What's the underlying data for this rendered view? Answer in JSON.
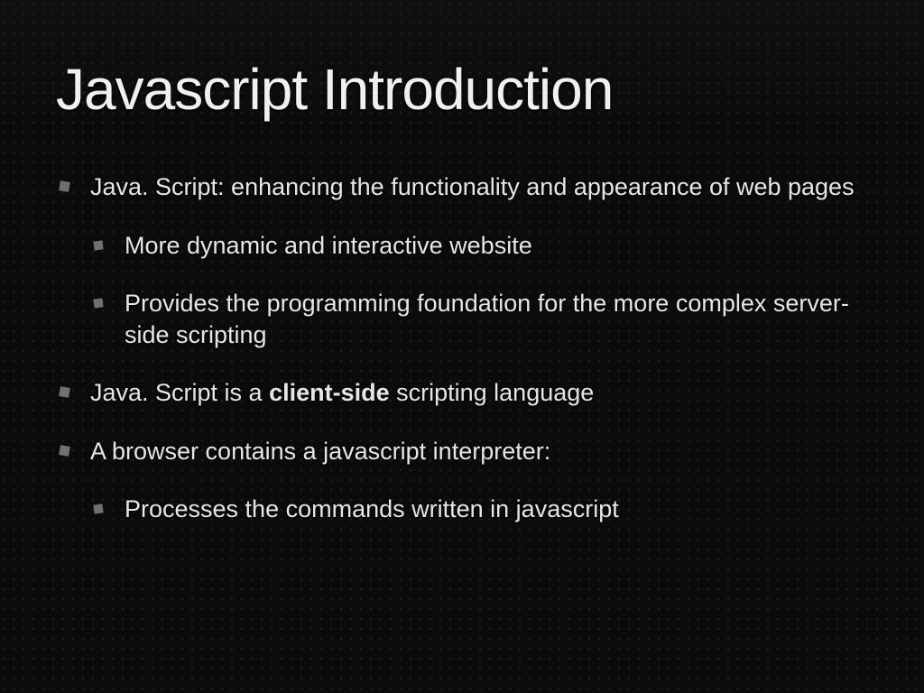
{
  "title": "Javascript Introduction",
  "bullets": {
    "b1": "Java. Script: enhancing the functionality and appearance of web pages",
    "b1_1": "More dynamic and interactive website",
    "b1_2": "Provides the programming foundation for the more complex server-side scripting",
    "b2_pre": "Java. Script is a ",
    "b2_bold": "client-side",
    "b2_post": " scripting language",
    "b3": "A browser contains a javascript interpreter:",
    "b3_1": "Processes the commands written in javascript"
  }
}
